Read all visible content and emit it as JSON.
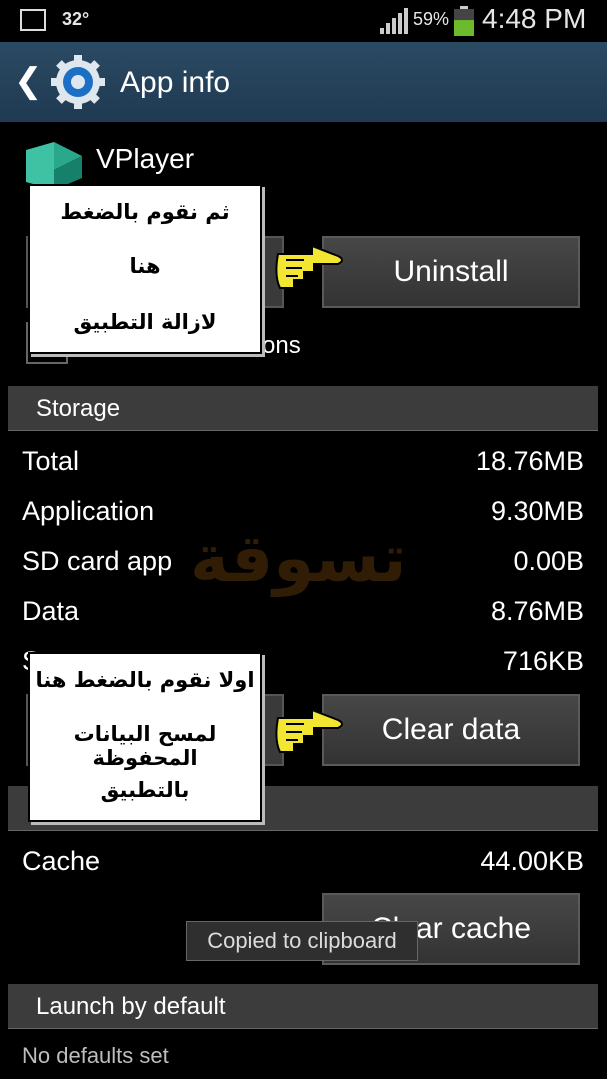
{
  "status_bar": {
    "temperature": "32°",
    "battery_percent": "59%",
    "time": "4:48 PM",
    "battery_level": 0.59
  },
  "action_bar": {
    "title": "App info",
    "back_icon": "back-arrow-icon",
    "app_icon": "settings-gear-icon"
  },
  "app": {
    "name": "VPlayer"
  },
  "buttons": {
    "uninstall": "Uninstall",
    "clear_data": "Clear data",
    "clear_cache": "Clear cache"
  },
  "notifications_tail": "ons",
  "storage": {
    "header": "Storage",
    "rows": [
      {
        "label": "Total",
        "value": "18.76MB"
      },
      {
        "label": "Application",
        "value": "9.30MB"
      },
      {
        "label": "SD card app",
        "value": "0.00B"
      },
      {
        "label": "Data",
        "value": "8.76MB"
      },
      {
        "label": "S",
        "value": "716KB"
      }
    ]
  },
  "cache": {
    "label": "Cache",
    "value": "44.00KB"
  },
  "launch": {
    "header": "Launch by default",
    "no_defaults": "No defaults set"
  },
  "toast": "Copied to clipboard",
  "callout_top": {
    "line1": "ثم نقوم بالضغط",
    "line2": "هنا",
    "line3": "لازالة التطبيق"
  },
  "callout_bottom": {
    "line1": "اولا نقوم بالضغط هنا",
    "line2": "لمسح البيانات المحفوظة",
    "line3": "بالتطبيق"
  },
  "watermark": "تسوقة",
  "colors": {
    "action_bar": "#2b4a63",
    "section": "#3c3c3c",
    "hand": "#f3e633"
  }
}
